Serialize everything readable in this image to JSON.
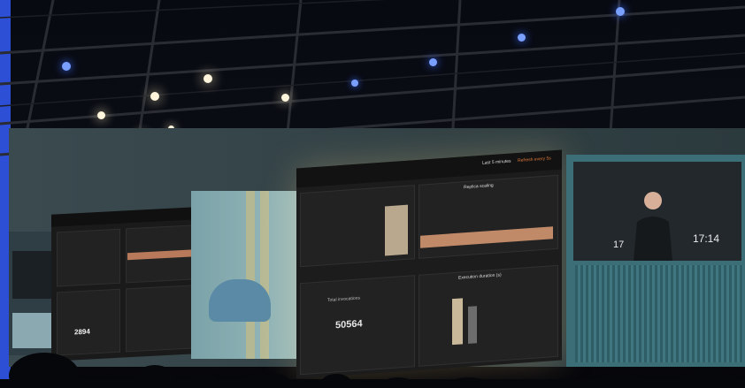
{
  "scene": {
    "description_visible_text": true,
    "screen_right": {
      "clock_main": "17:14",
      "clock_small": "17"
    },
    "dashboard_main": {
      "panel_title": "Replica scaling",
      "time_range": "Last 5 minutes",
      "refresh": "Refresh every 5s",
      "panel2_title": "Execution duration (s)",
      "total_number": "50564",
      "total_label": "Total invocations"
    },
    "dashboard_left": {
      "number": "2894"
    }
  },
  "colors": {
    "accent_blue": "#2d4fd6",
    "screen_teal": "#3c6e77",
    "dashboard_bg": "#1c1c1c",
    "highlight_orange": "#e07a3a"
  }
}
